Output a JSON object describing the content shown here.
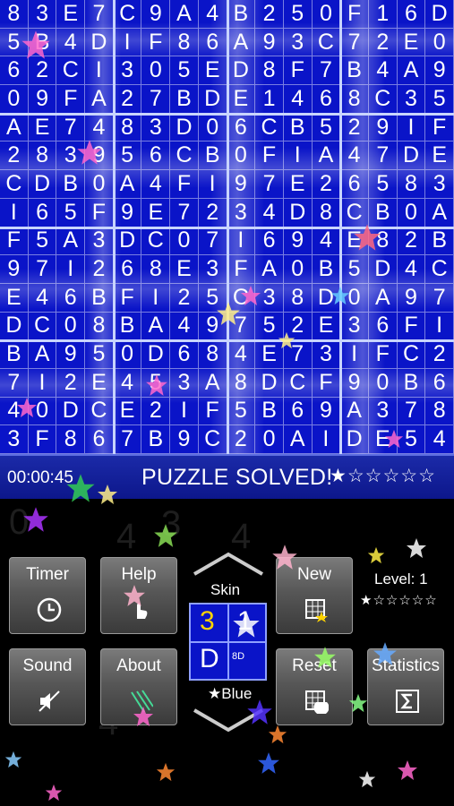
{
  "board": {
    "rows": [
      [
        "8",
        "3",
        "E",
        "7",
        "C",
        "9",
        "A",
        "4",
        "B",
        "2",
        "5",
        "0",
        "F",
        "1",
        "6",
        "D"
      ],
      [
        "5",
        "B",
        "4",
        "D",
        "I",
        "F",
        "8",
        "6",
        "A",
        "9",
        "3",
        "C",
        "7",
        "2",
        "E",
        "0"
      ],
      [
        "6",
        "2",
        "C",
        "I",
        "3",
        "0",
        "5",
        "E",
        "D",
        "8",
        "F",
        "7",
        "B",
        "4",
        "A",
        "9"
      ],
      [
        "0",
        "9",
        "F",
        "A",
        "2",
        "7",
        "B",
        "D",
        "E",
        "1",
        "4",
        "6",
        "8",
        "C",
        "3",
        "5"
      ],
      [
        "A",
        "E",
        "7",
        "4",
        "8",
        "3",
        "D",
        "0",
        "6",
        "C",
        "B",
        "5",
        "2",
        "9",
        "I",
        "F"
      ],
      [
        "2",
        "8",
        "3",
        "9",
        "5",
        "6",
        "C",
        "B",
        "0",
        "F",
        "I",
        "A",
        "4",
        "7",
        "D",
        "E"
      ],
      [
        "C",
        "D",
        "B",
        "0",
        "A",
        "4",
        "F",
        "I",
        "9",
        "7",
        "E",
        "2",
        "6",
        "5",
        "8",
        "3"
      ],
      [
        "I",
        "6",
        "5",
        "F",
        "9",
        "E",
        "7",
        "2",
        "3",
        "4",
        "D",
        "8",
        "C",
        "B",
        "0",
        "A"
      ],
      [
        "F",
        "5",
        "A",
        "3",
        "D",
        "C",
        "0",
        "7",
        "I",
        "6",
        "9",
        "4",
        "E",
        "8",
        "2",
        "B"
      ],
      [
        "9",
        "7",
        "I",
        "2",
        "6",
        "8",
        "E",
        "3",
        "F",
        "A",
        "0",
        "B",
        "5",
        "D",
        "4",
        "C"
      ],
      [
        "E",
        "4",
        "6",
        "B",
        "F",
        "I",
        "2",
        "5",
        "C",
        "3",
        "8",
        "D",
        "0",
        "A",
        "9",
        "7"
      ],
      [
        "D",
        "C",
        "0",
        "8",
        "B",
        "A",
        "4",
        "9",
        "7",
        "5",
        "2",
        "E",
        "3",
        "6",
        "F",
        "I"
      ],
      [
        "B",
        "A",
        "9",
        "5",
        "0",
        "D",
        "6",
        "8",
        "4",
        "E",
        "7",
        "3",
        "I",
        "F",
        "C",
        "2"
      ],
      [
        "7",
        "I",
        "2",
        "E",
        "4",
        "5",
        "3",
        "A",
        "8",
        "D",
        "C",
        "F",
        "9",
        "0",
        "B",
        "6"
      ],
      [
        "4",
        "0",
        "D",
        "C",
        "E",
        "2",
        "I",
        "F",
        "5",
        "B",
        "6",
        "9",
        "A",
        "3",
        "7",
        "8"
      ],
      [
        "3",
        "F",
        "8",
        "6",
        "7",
        "B",
        "9",
        "C",
        "2",
        "0",
        "A",
        "I",
        "D",
        "E",
        "5",
        "4"
      ]
    ]
  },
  "status": {
    "timer": "00:00:45",
    "message": "PUZZLE SOLVED!",
    "rating": "★☆☆☆☆☆"
  },
  "controls": {
    "timer_label": "Timer",
    "help_label": "Help",
    "new_label": "New",
    "sound_label": "Sound",
    "about_label": "About",
    "reset_label": "Reset",
    "statistics_label": "Statistics",
    "skin_label": "Skin",
    "skin_name": "Blue",
    "skin_tile": {
      "a": "3",
      "b": "1",
      "c": "D",
      "d": "8D"
    },
    "level_label": "Level: 1",
    "level_stars": "★☆☆☆☆☆"
  },
  "colors": {
    "board_bg": "#0a14c8",
    "accent": "#8fa0ff"
  }
}
